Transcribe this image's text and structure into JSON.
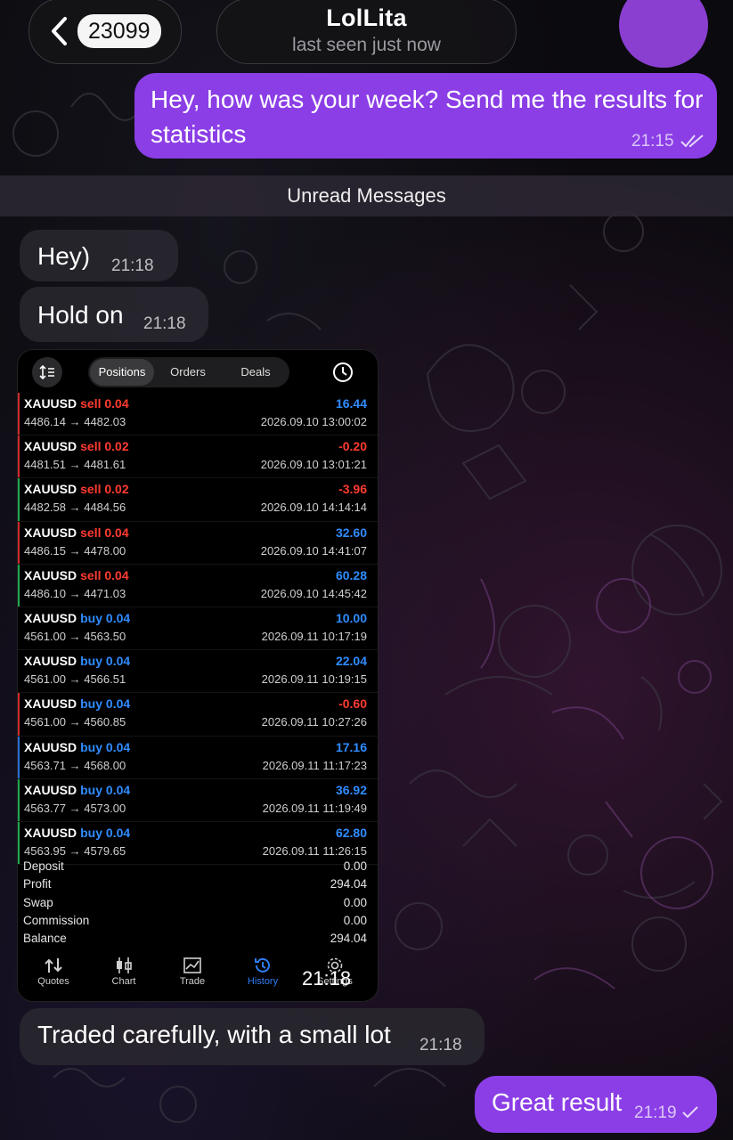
{
  "header": {
    "back_count": "23099",
    "chat_name": "LolLita",
    "chat_status": "last seen just now"
  },
  "messages": {
    "m1": {
      "text": "Hey, how was your week? Send me the results for statistics",
      "time": "21:15"
    },
    "unread_label": "Unread Messages",
    "m2": {
      "text": "Hey)",
      "time": "21:18"
    },
    "m3": {
      "text": "Hold on",
      "time": "21:18"
    },
    "m4_time": "21:18",
    "m5": {
      "text": "Traded carefully, with a small lot",
      "time": "21:18"
    },
    "m6": {
      "text": "Great result",
      "time": "21:19"
    }
  },
  "trade_app": {
    "tabs": [
      "Positions",
      "Orders",
      "Deals"
    ],
    "active_tab": "Positions",
    "trades": [
      {
        "symbol": "XAUUSD",
        "side": "sell 0.04",
        "prices": "4486.14 → 4482.03",
        "pnl": "16.44",
        "datetime": "2026.09.10 13:00:02",
        "side_color": "#ff3b30",
        "pnl_color": "#2f8cff",
        "bar_color": "#d12a2a"
      },
      {
        "symbol": "XAUUSD",
        "side": "sell 0.02",
        "prices": "4481.51 → 4481.61",
        "pnl": "-0.20",
        "datetime": "2026.09.10 13:01:21",
        "side_color": "#ff3b30",
        "pnl_color": "#ff3b30",
        "bar_color": "#d12a2a"
      },
      {
        "symbol": "XAUUSD",
        "side": "sell 0.02",
        "prices": "4482.58 → 4484.56",
        "pnl": "-3.96",
        "datetime": "2026.09.10 14:14:14",
        "side_color": "#ff3b30",
        "pnl_color": "#ff3b30",
        "bar_color": "#1fa84f"
      },
      {
        "symbol": "XAUUSD",
        "side": "sell 0.04",
        "prices": "4486.15 → 4478.00",
        "pnl": "32.60",
        "datetime": "2026.09.10 14:41:07",
        "side_color": "#ff3b30",
        "pnl_color": "#2f8cff",
        "bar_color": "#d12a2a"
      },
      {
        "symbol": "XAUUSD",
        "side": "sell 0.04",
        "prices": "4486.10 → 4471.03",
        "pnl": "60.28",
        "datetime": "2026.09.10 14:45:42",
        "side_color": "#ff3b30",
        "pnl_color": "#2f8cff",
        "bar_color": "#1fa84f"
      },
      {
        "symbol": "XAUUSD",
        "side": "buy 0.04",
        "prices": "4561.00 → 4563.50",
        "pnl": "10.00",
        "datetime": "2026.09.11 10:17:19",
        "side_color": "#2f8cff",
        "pnl_color": "#2f8cff",
        "bar_color": "#000000"
      },
      {
        "symbol": "XAUUSD",
        "side": "buy 0.04",
        "prices": "4561.00 → 4566.51",
        "pnl": "22.04",
        "datetime": "2026.09.11 10:19:15",
        "side_color": "#2f8cff",
        "pnl_color": "#2f8cff",
        "bar_color": "#000000"
      },
      {
        "symbol": "XAUUSD",
        "side": "buy 0.04",
        "prices": "4561.00 → 4560.85",
        "pnl": "-0.60",
        "datetime": "2026.09.11 10:27:26",
        "side_color": "#2f8cff",
        "pnl_color": "#ff3b30",
        "bar_color": "#d12a2a"
      },
      {
        "symbol": "XAUUSD",
        "side": "buy 0.04",
        "prices": "4563.71 → 4568.00",
        "pnl": "17.16",
        "datetime": "2026.09.11 11:17:23",
        "side_color": "#2f8cff",
        "pnl_color": "#2f8cff",
        "bar_color": "#2a6fd6"
      },
      {
        "symbol": "XAUUSD",
        "side": "buy 0.04",
        "prices": "4563.77 → 4573.00",
        "pnl": "36.92",
        "datetime": "2026.09.11 11:19:49",
        "side_color": "#2f8cff",
        "pnl_color": "#2f8cff",
        "bar_color": "#1fa84f"
      },
      {
        "symbol": "XAUUSD",
        "side": "buy 0.04",
        "prices": "4563.95 → 4579.65",
        "pnl": "62.80",
        "datetime": "2026.09.11 11:26:15",
        "side_color": "#2f8cff",
        "pnl_color": "#2f8cff",
        "bar_color": "#1fa84f"
      }
    ],
    "summary": [
      {
        "label": "Deposit",
        "value": "0.00"
      },
      {
        "label": "Profit",
        "value": "294.04"
      },
      {
        "label": "Swap",
        "value": "0.00"
      },
      {
        "label": "Commission",
        "value": "0.00"
      },
      {
        "label": "Balance",
        "value": "294.04"
      }
    ],
    "nav": [
      "Quotes",
      "Chart",
      "Trade",
      "History",
      "Settings"
    ],
    "active_nav": "History"
  },
  "colors": {
    "outgoing_bubble": "#8b3ee6",
    "incoming_bubble": "#28262e",
    "active_nav": "#2f7cf6"
  }
}
